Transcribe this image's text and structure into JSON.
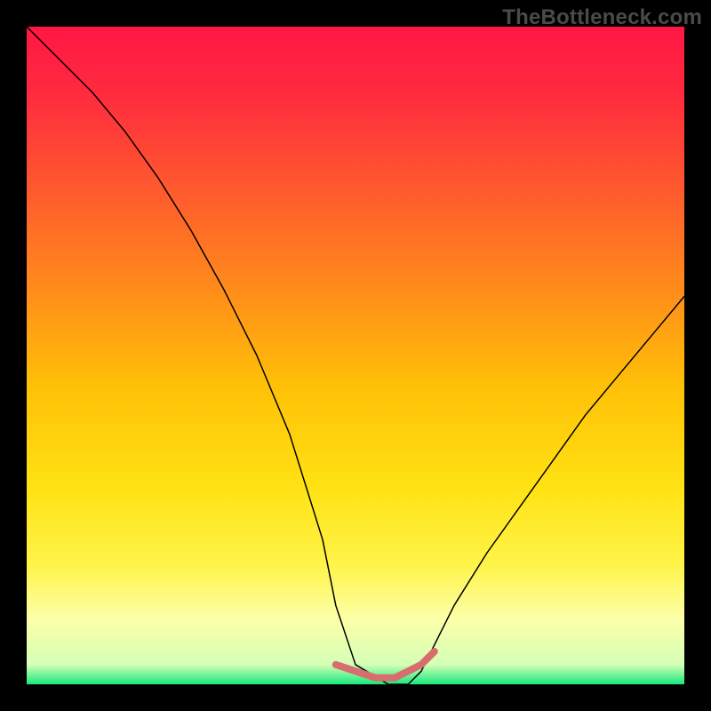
{
  "watermark": "TheBottleneck.com",
  "chart_data": {
    "type": "line",
    "title": "",
    "xlabel": "",
    "ylabel": "",
    "xlim": [
      0,
      100
    ],
    "ylim": [
      0,
      100
    ],
    "background_gradient": {
      "stops": [
        {
          "offset": 0.0,
          "color": "#ff1744"
        },
        {
          "offset": 0.1,
          "color": "#ff2a3f"
        },
        {
          "offset": 0.25,
          "color": "#ff5a2e"
        },
        {
          "offset": 0.4,
          "color": "#ff8c1a"
        },
        {
          "offset": 0.55,
          "color": "#ffc107"
        },
        {
          "offset": 0.7,
          "color": "#ffe213"
        },
        {
          "offset": 0.82,
          "color": "#fff44a"
        },
        {
          "offset": 0.9,
          "color": "#fcffa8"
        },
        {
          "offset": 0.97,
          "color": "#d5ffb6"
        },
        {
          "offset": 1.0,
          "color": "#17e87d"
        }
      ]
    },
    "series": [
      {
        "name": "curve",
        "color": "#000000",
        "width": 1.5,
        "x": [
          0,
          5,
          10,
          15,
          20,
          25,
          30,
          35,
          40,
          45,
          47,
          50,
          55,
          58,
          60,
          62,
          65,
          70,
          75,
          80,
          85,
          90,
          95,
          100
        ],
        "values": [
          100,
          95,
          90,
          84,
          77,
          69,
          60,
          50,
          38,
          22,
          12,
          3,
          0,
          0,
          2,
          6,
          12,
          20,
          27,
          34,
          41,
          47,
          53,
          59
        ]
      },
      {
        "name": "floor-highlight",
        "color": "#d86d6d",
        "width": 8,
        "x": [
          47,
          50,
          53,
          56,
          58,
          60,
          62
        ],
        "values": [
          3,
          2,
          1,
          1,
          2,
          3,
          5
        ]
      }
    ]
  }
}
